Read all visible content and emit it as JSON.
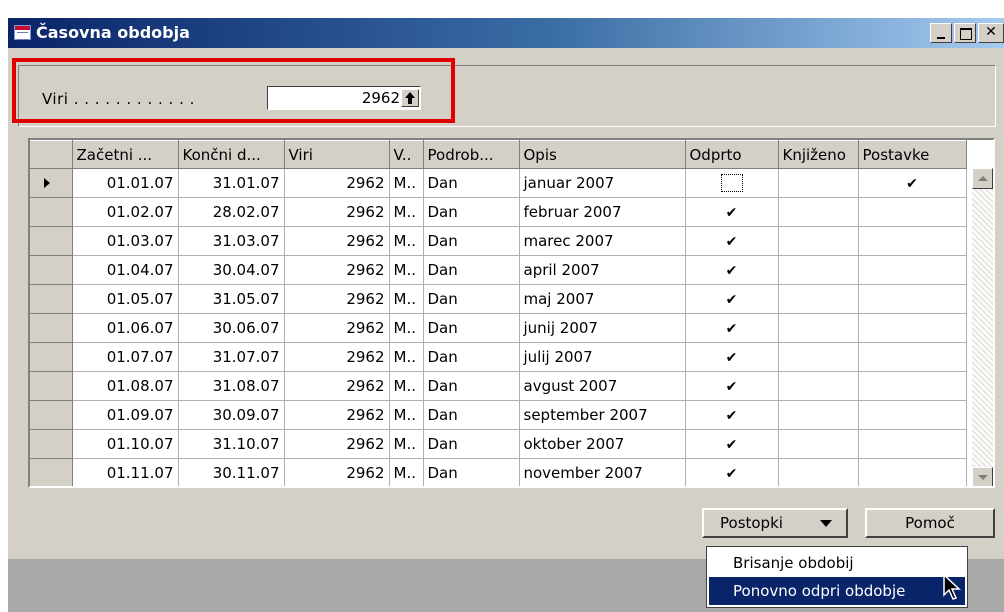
{
  "window": {
    "title": "Časovna obdobja"
  },
  "header": {
    "viri_label": "Viri . . . . . . . . . . . .",
    "viri_value": "2962"
  },
  "grid": {
    "columns": [
      "Začetni ...",
      "Končni d...",
      "Viri",
      "V..",
      "Podrob...",
      "Opis",
      "Odprto",
      "Knjiženo",
      "Postavke"
    ],
    "rows": [
      {
        "start": "01.01.07",
        "end": "31.01.07",
        "viri": "2962",
        "v": "M..",
        "detail": "Dan",
        "desc": "januar 2007",
        "odprto": "",
        "knjizeno": "",
        "postavke": "✔"
      },
      {
        "start": "01.02.07",
        "end": "28.02.07",
        "viri": "2962",
        "v": "M..",
        "detail": "Dan",
        "desc": "februar 2007",
        "odprto": "✔",
        "knjizeno": "",
        "postavke": ""
      },
      {
        "start": "01.03.07",
        "end": "31.03.07",
        "viri": "2962",
        "v": "M..",
        "detail": "Dan",
        "desc": "marec 2007",
        "odprto": "✔",
        "knjizeno": "",
        "postavke": ""
      },
      {
        "start": "01.04.07",
        "end": "30.04.07",
        "viri": "2962",
        "v": "M..",
        "detail": "Dan",
        "desc": "april 2007",
        "odprto": "✔",
        "knjizeno": "",
        "postavke": ""
      },
      {
        "start": "01.05.07",
        "end": "31.05.07",
        "viri": "2962",
        "v": "M..",
        "detail": "Dan",
        "desc": "maj 2007",
        "odprto": "✔",
        "knjizeno": "",
        "postavke": ""
      },
      {
        "start": "01.06.07",
        "end": "30.06.07",
        "viri": "2962",
        "v": "M..",
        "detail": "Dan",
        "desc": "junij 2007",
        "odprto": "✔",
        "knjizeno": "",
        "postavke": ""
      },
      {
        "start": "01.07.07",
        "end": "31.07.07",
        "viri": "2962",
        "v": "M..",
        "detail": "Dan",
        "desc": "julij 2007",
        "odprto": "✔",
        "knjizeno": "",
        "postavke": ""
      },
      {
        "start": "01.08.07",
        "end": "31.08.07",
        "viri": "2962",
        "v": "M..",
        "detail": "Dan",
        "desc": "avgust 2007",
        "odprto": "✔",
        "knjizeno": "",
        "postavke": ""
      },
      {
        "start": "01.09.07",
        "end": "30.09.07",
        "viri": "2962",
        "v": "M..",
        "detail": "Dan",
        "desc": "september 2007",
        "odprto": "✔",
        "knjizeno": "",
        "postavke": ""
      },
      {
        "start": "01.10.07",
        "end": "31.10.07",
        "viri": "2962",
        "v": "M..",
        "detail": "Dan",
        "desc": "oktober 2007",
        "odprto": "✔",
        "knjizeno": "",
        "postavke": ""
      },
      {
        "start": "01.11.07",
        "end": "30.11.07",
        "viri": "2962",
        "v": "M..",
        "detail": "Dan",
        "desc": "november 2007",
        "odprto": "✔",
        "knjizeno": "",
        "postavke": ""
      }
    ]
  },
  "buttons": {
    "postopki": "Postopki",
    "pomoc": "Pomoč"
  },
  "menu": {
    "items": [
      "Brisanje obdobij",
      "Ponovno odpri obdobje"
    ],
    "selected_index": 1
  },
  "colors": {
    "title_start": "#0a246a",
    "title_end": "#a6caf0",
    "highlight": "#e00000",
    "menu_selected": "#0a246a"
  }
}
